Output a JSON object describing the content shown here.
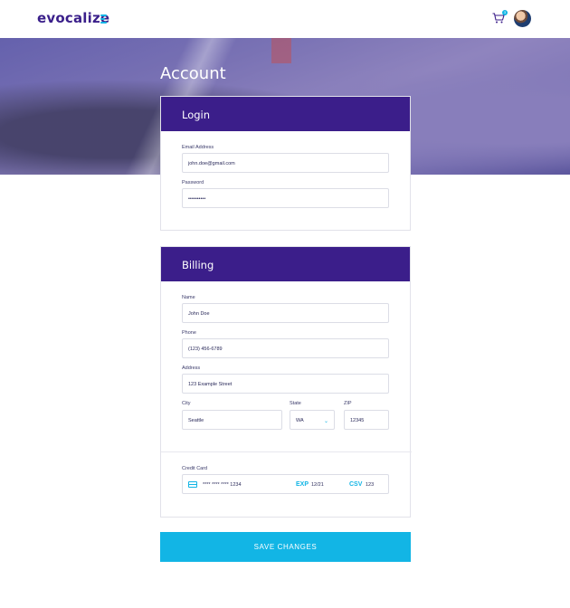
{
  "header": {
    "logo_text": "evocalize",
    "cart_icon": "cart-icon",
    "cart_badge": "3",
    "avatar_icon": "avatar"
  },
  "page": {
    "title": "Account"
  },
  "login": {
    "title": "Login",
    "email_label": "Email Address",
    "email_value": "john.doe@gmail.com",
    "password_label": "Password",
    "password_value": "••••••••••"
  },
  "billing": {
    "title": "Billing",
    "name_label": "Name",
    "name_value": "John Doe",
    "phone_label": "Phone",
    "phone_value": "(123) 456-6789",
    "address_label": "Address",
    "address_value": "123 Example Street",
    "city_label": "City",
    "city_value": "Seattle",
    "state_label": "State",
    "state_value": "WA",
    "zip_label": "ZIP",
    "zip_value": "12345",
    "card_label": "Credit Card",
    "card_number": "**** **** **** 1234",
    "exp_label": "EXP",
    "exp_value": "12/21",
    "csv_label": "CSV",
    "csv_value": "123",
    "card_icon": "credit-card-icon"
  },
  "actions": {
    "save_label": "SAVE CHANGES"
  },
  "colors": {
    "brand": "#3b1e8a",
    "accent": "#12b5e5"
  }
}
